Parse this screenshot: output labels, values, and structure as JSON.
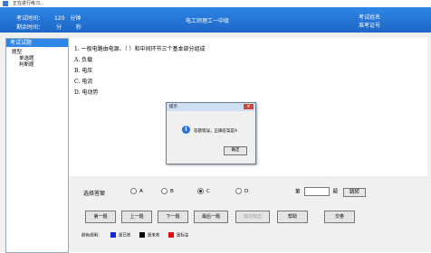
{
  "window": {
    "title": "正在进行练习..."
  },
  "banner": {
    "exam_time_label": "考试时间：",
    "exam_time_value": "120",
    "exam_time_unit": "分钟",
    "remaining_label": "剩余时间：",
    "remaining_min_unit": "分",
    "remaining_sec_unit": "秒",
    "center_title": "电工师理工一中级",
    "name_label": "考试姓名",
    "id_label": "准考证号",
    "small_text": "..."
  },
  "sidebar": {
    "header": "考试试题",
    "tree_root": "题型",
    "items": [
      "单选题",
      "判断题"
    ]
  },
  "question": {
    "stem": "1. 一般电路由电源、（ ）和中间环节三个基本部分组成",
    "options": [
      "A. 负载",
      "B. 电压",
      "C. 电流",
      "D. 电动势"
    ]
  },
  "dialog": {
    "title": "提示",
    "message": "答题错误，正确答案是A",
    "ok_label": "确定",
    "close_label": "×"
  },
  "answer": {
    "label": "选择答案",
    "choices": [
      "A",
      "B",
      "C",
      "D"
    ],
    "selected": "C",
    "goto_prefix": "第",
    "goto_suffix": "题",
    "goto_button": "跳转"
  },
  "nav": {
    "first": "第一题",
    "prev": "上一题",
    "next": "下一题",
    "last": "最后一题",
    "mark": "加注标志",
    "help": "帮助",
    "submit": "交卷"
  },
  "legend": {
    "label": "颜色说明：",
    "items": [
      {
        "text": "是已答",
        "color": "#1428d8"
      },
      {
        "text": "是未答",
        "color": "#000000"
      },
      {
        "text": "是标注",
        "color": "#e01010"
      }
    ]
  }
}
